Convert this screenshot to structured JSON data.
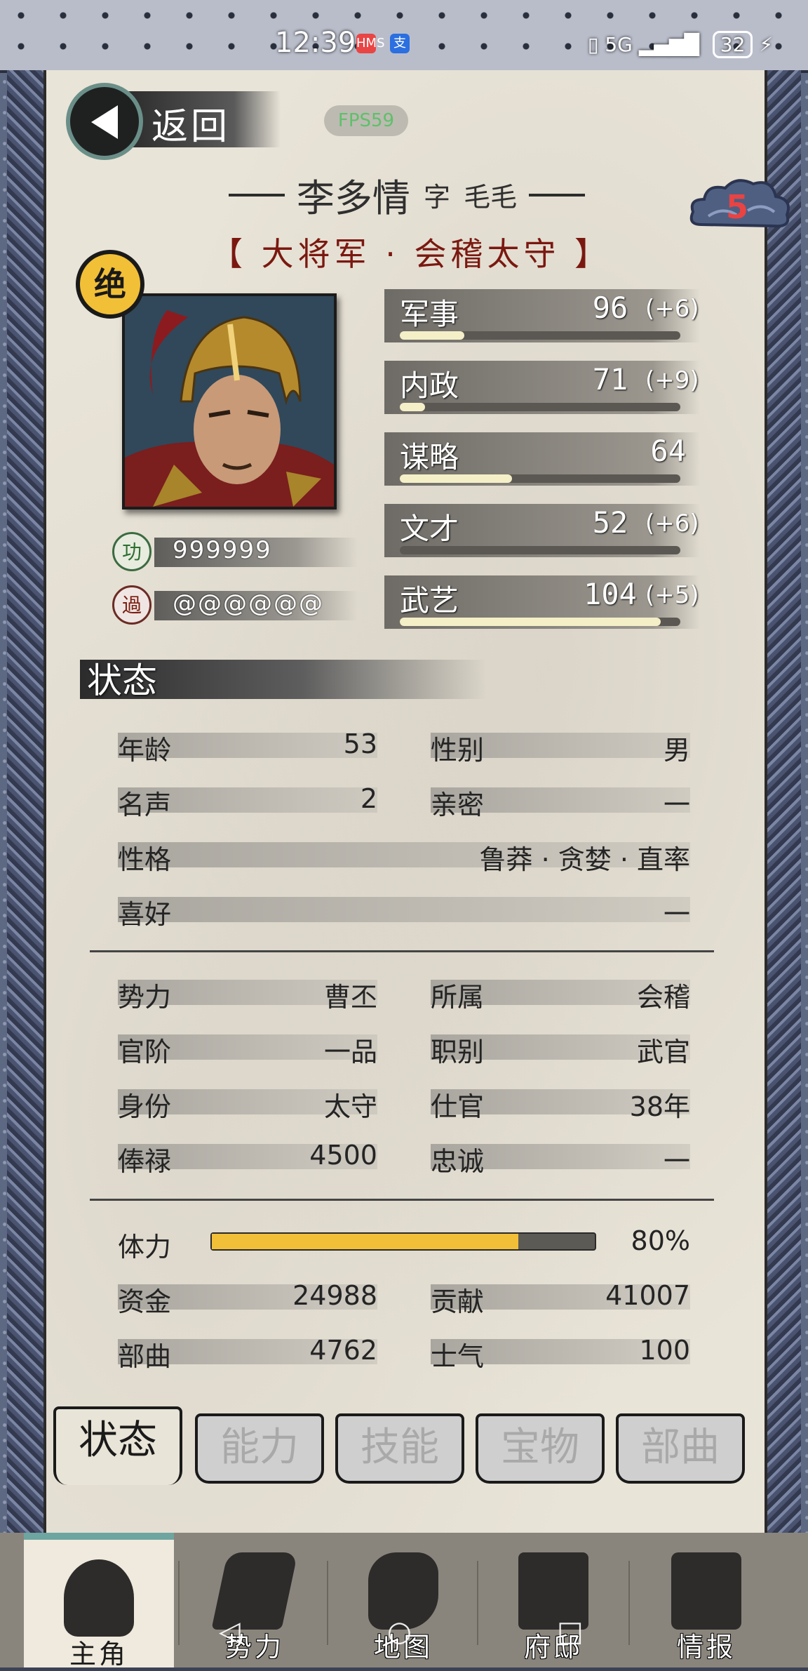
{
  "statusbar": {
    "time": "12:39",
    "app1": "HMS",
    "app2": "支",
    "network": "5G",
    "battery": "32"
  },
  "header": {
    "back_label": "返回",
    "fps": "FPS59"
  },
  "character": {
    "name": "李多情",
    "courtesy_label": "字",
    "courtesy_name": "毛毛",
    "title": "【 大将军 · 会稽太守 】",
    "rank_badge": "绝",
    "cloud_badge": "5",
    "merit_seal": "功",
    "fault_seal": "過",
    "merit_pips": "999999",
    "fault_pips": "@@@@@@"
  },
  "stats": [
    {
      "label": "军事",
      "value": "96",
      "bonus": "(+6)",
      "bar": 0.23
    },
    {
      "label": "内政",
      "value": "71",
      "bonus": "(+9)",
      "bar": 0.09
    },
    {
      "label": "谋略",
      "value": "64",
      "bonus": "",
      "bar": 0.4
    },
    {
      "label": "文才",
      "value": "52",
      "bonus": "(+6)",
      "bar": 0.0
    },
    {
      "label": "武艺",
      "value": "104",
      "bonus": "(+5)",
      "bar": 0.93
    }
  ],
  "status_section": {
    "title": "状态",
    "age_label": "年龄",
    "age": "53",
    "gender_label": "性别",
    "gender": "男",
    "fame_label": "名声",
    "fame": "2",
    "intimacy_label": "亲密",
    "intimacy": "一",
    "personality_label": "性格",
    "personality": "鲁莽 · 贪婪 · 直率",
    "hobby_label": "喜好",
    "hobby": "一",
    "faction_label": "势力",
    "faction": "曹丕",
    "belong_label": "所属",
    "belong": "会稽",
    "rank_label": "官阶",
    "rank": "一品",
    "job_label": "职别",
    "job": "武官",
    "identity_label": "身份",
    "identity": "太守",
    "service_label": "仕官",
    "service": "38年",
    "salary_label": "俸禄",
    "salary": "4500",
    "loyalty_label": "忠诚",
    "loyalty": "一",
    "stamina_label": "体力",
    "stamina": "80%",
    "stamina_value": 0.8,
    "funds_label": "资金",
    "funds": "24988",
    "contribution_label": "贡献",
    "contribution": "41007",
    "troops_label": "部曲",
    "troops": "4762",
    "morale_label": "士气",
    "morale": "100"
  },
  "tabs": [
    "状态",
    "能力",
    "技能",
    "宝物",
    "部曲"
  ],
  "bottom_nav": [
    "主角",
    "势力",
    "地图",
    "府邸",
    "情报"
  ]
}
